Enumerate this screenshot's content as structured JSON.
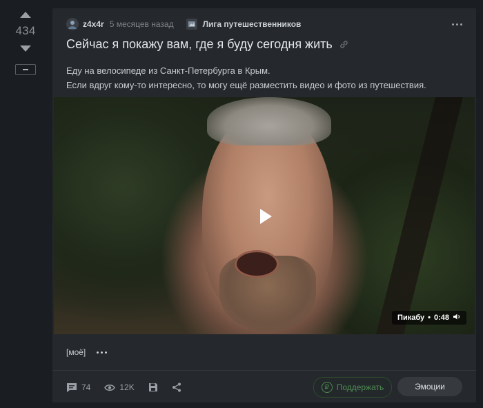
{
  "vote": {
    "count": "434"
  },
  "post": {
    "author": "z4x4r",
    "time": "5 месяцев назад",
    "community": "Лига путешественников",
    "title": "Сейчас я покажу вам, где я буду сегодня жить",
    "text_lines": [
      "Еду на велосипеде из Санкт-Петербурга в Крым.",
      "Если вдруг кому-то интересно, то могу ещё разместить видео и фото из путешествия."
    ],
    "video": {
      "source": "Пикабу",
      "duration": "0:48"
    },
    "tags": [
      "[моё]"
    ]
  },
  "footer": {
    "comments": "74",
    "views": "12K",
    "support_label": "Поддержать",
    "emotions_label": "Эмоции"
  },
  "colors": {
    "background": "#1a1d21",
    "card": "#25282c",
    "support": "#4e8a54"
  }
}
